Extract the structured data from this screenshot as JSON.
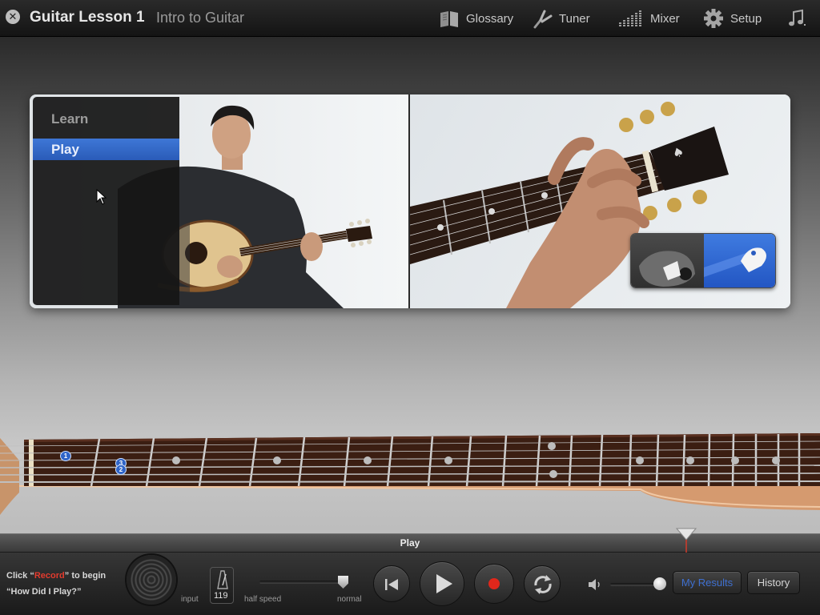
{
  "header": {
    "lesson_title": "Guitar Lesson 1",
    "lesson_subtitle": "Intro to Guitar",
    "toolbar": [
      {
        "label": "Glossary",
        "icon": "book-icon"
      },
      {
        "label": "Tuner",
        "icon": "tuning-fork-icon"
      },
      {
        "label": "Mixer",
        "icon": "mixer-icon"
      },
      {
        "label": "Setup",
        "icon": "gear-icon"
      },
      {
        "label": "",
        "icon": "music-note-icon"
      }
    ]
  },
  "video": {
    "menu": [
      {
        "label": "Learn",
        "selected": false
      },
      {
        "label": "Play",
        "selected": true
      }
    ]
  },
  "fretboard": {
    "finger_markers": [
      "1",
      "3",
      "2"
    ]
  },
  "transport": {
    "section_label": "Play",
    "hint_prefix": "Click “",
    "hint_keyword": "Record",
    "hint_suffix": "” to begin",
    "hint_line2": "“How Did I Play?”",
    "input_label": "input",
    "tempo": "119",
    "speed_min_label": "half speed",
    "speed_max_label": "normal",
    "my_results_label": "My Results",
    "history_label": "History"
  },
  "colors": {
    "accent_blue": "#2f64c8",
    "record_red": "#e0271b",
    "hint_red": "#e33b2e"
  }
}
